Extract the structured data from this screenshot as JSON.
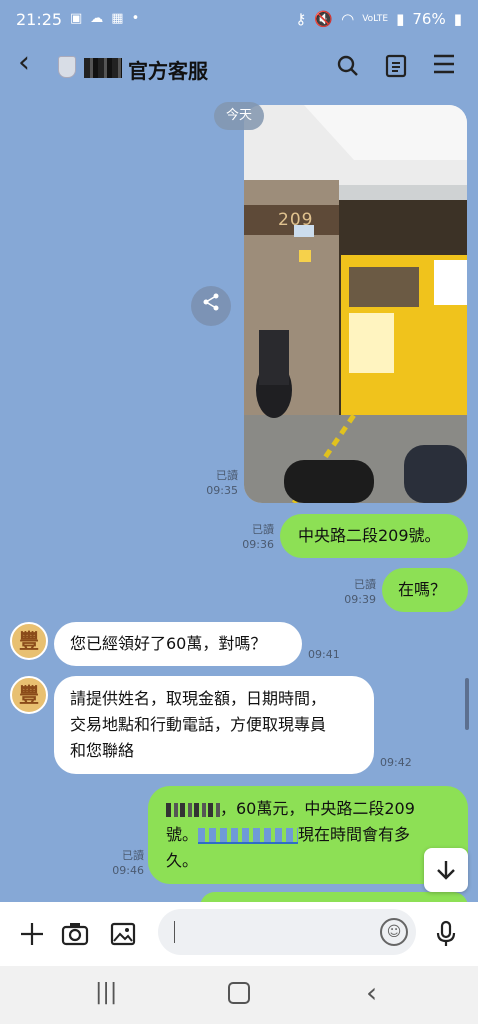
{
  "status": {
    "time": "21:25",
    "battery": "76%",
    "network": "VoLTE"
  },
  "header": {
    "title": "官方客服",
    "back_icon": "chevron-left-icon"
  },
  "date_divider": "今天",
  "messages": [
    {
      "from": "me",
      "type": "image",
      "status": "已讀",
      "time": "09:35",
      "image_text": "209"
    },
    {
      "from": "me",
      "text": "中央路二段209號。",
      "status": "已讀",
      "time": "09:36"
    },
    {
      "from": "me",
      "text": "在嗎？",
      "status": "已讀",
      "time": "09:39"
    },
    {
      "from": "them",
      "text": "您已經領好了60萬，對嗎？",
      "time": "09:41"
    },
    {
      "from": "them",
      "lines": [
        "請提供姓名，取現金額，日期時間，",
        "交易地點和行動電話，方便取現專員",
        "和您聯絡"
      ],
      "time": "09:42"
    },
    {
      "from": "me",
      "lines": [
        "，60萬元，中央路二段209",
        "號。",
        "現在時間會有多",
        "久。"
      ],
      "status": "已讀",
      "time": "09:46"
    }
  ]
}
